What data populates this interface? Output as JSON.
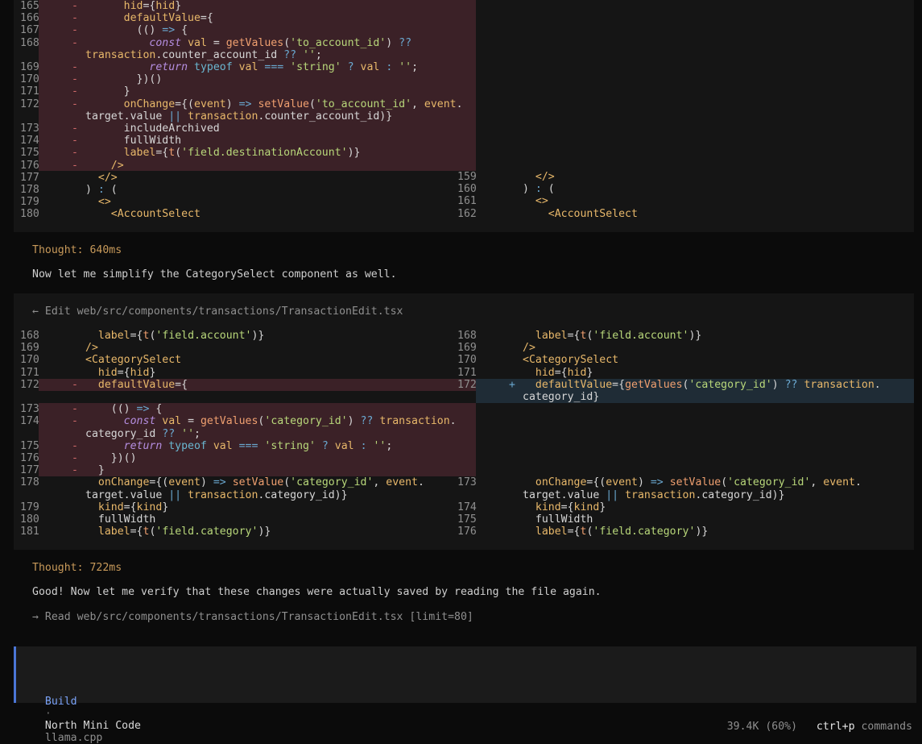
{
  "diff1": {
    "left": [
      {
        "n": "165",
        "m": "-",
        "code": "      hid={hid}",
        "del": true
      },
      {
        "n": "166",
        "m": "-",
        "code": "      defaultValue={",
        "del": true
      },
      {
        "n": "167",
        "m": "-",
        "code": "        (() => {",
        "del": true
      },
      {
        "n": "168",
        "m": "-",
        "code": "          const val = getValues('to_account_id') ??",
        "del": true
      },
      {
        "n": "",
        "m": "",
        "code": "transaction.counter_account_id ?? '';",
        "del": true
      },
      {
        "n": "169",
        "m": "-",
        "code": "          return typeof val === 'string' ? val : '';",
        "del": true
      },
      {
        "n": "170",
        "m": "-",
        "code": "        })()",
        "del": true
      },
      {
        "n": "171",
        "m": "-",
        "code": "      }",
        "del": true
      },
      {
        "n": "172",
        "m": "-",
        "code": "      onChange={(event) => setValue('to_account_id', event.",
        "del": true
      },
      {
        "n": "",
        "m": "",
        "code": "target.value || transaction.counter_account_id)}",
        "del": true
      },
      {
        "n": "173",
        "m": "-",
        "code": "      includeArchived",
        "del": true
      },
      {
        "n": "174",
        "m": "-",
        "code": "      fullWidth",
        "del": true
      },
      {
        "n": "175",
        "m": "-",
        "code": "      label={t('field.destinationAccount')}",
        "del": true
      },
      {
        "n": "176",
        "m": "-",
        "code": "    />",
        "del": true
      },
      {
        "n": "177",
        "m": "",
        "code": "  </>",
        "del": false
      },
      {
        "n": "178",
        "m": "",
        "code": ") : (",
        "del": false
      },
      {
        "n": "179",
        "m": "",
        "code": "  <>",
        "del": false
      },
      {
        "n": "180",
        "m": "",
        "code": "    <AccountSelect",
        "del": false
      }
    ],
    "right": [
      {
        "n": "159",
        "code": "  </>"
      },
      {
        "n": "160",
        "code": ") : ("
      },
      {
        "n": "161",
        "code": "  <>"
      },
      {
        "n": "162",
        "code": "    <AccountSelect"
      }
    ]
  },
  "thought1": "Thought: 640ms",
  "message1": "Now let me simplify the CategorySelect component as well.",
  "edit_header": "← Edit web/src/components/transactions/TransactionEdit.tsx",
  "diff2": {
    "left": [
      {
        "n": "168",
        "m": "",
        "code": "  label={t('field.account')}"
      },
      {
        "n": "169",
        "m": "",
        "code": "/>"
      },
      {
        "n": "170",
        "m": "",
        "code": "<CategorySelect"
      },
      {
        "n": "171",
        "m": "",
        "code": "  hid={hid}"
      },
      {
        "n": "172",
        "m": "-",
        "code": "  defaultValue={"
      },
      {
        "n": "173",
        "m": "-",
        "code": "    (() => {"
      },
      {
        "n": "174",
        "m": "-",
        "code": "      const val = getValues('category_id') ?? transaction."
      },
      {
        "n": "",
        "m": "",
        "code": "category_id ?? '';"
      },
      {
        "n": "175",
        "m": "-",
        "code": "      return typeof val === 'string' ? val : '';"
      },
      {
        "n": "176",
        "m": "-",
        "code": "    })()"
      },
      {
        "n": "177",
        "m": "-",
        "code": "  }"
      },
      {
        "n": "178",
        "m": "",
        "code": "  onChange={(event) => setValue('category_id', event."
      },
      {
        "n": "",
        "m": "",
        "code": "target.value || transaction.category_id)}"
      },
      {
        "n": "179",
        "m": "",
        "code": "  kind={kind}"
      },
      {
        "n": "180",
        "m": "",
        "code": "  fullWidth"
      },
      {
        "n": "181",
        "m": "",
        "code": "  label={t('field.category')}"
      }
    ],
    "right": [
      {
        "n": "168",
        "m": "",
        "code": "  label={t('field.account')}"
      },
      {
        "n": "169",
        "m": "",
        "code": "/>"
      },
      {
        "n": "170",
        "m": "",
        "code": "<CategorySelect"
      },
      {
        "n": "171",
        "m": "",
        "code": "  hid={hid}"
      },
      {
        "n": "172",
        "m": "+",
        "code": "  defaultValue={getValues('category_id') ?? transaction."
      },
      {
        "n": "",
        "m": "",
        "code": "category_id}"
      },
      {
        "n": "173",
        "m": "",
        "code": "  onChange={(event) => setValue('category_id', event."
      },
      {
        "n": "",
        "m": "",
        "code": "target.value || transaction.category_id)}"
      },
      {
        "n": "174",
        "m": "",
        "code": "  kind={kind}"
      },
      {
        "n": "175",
        "m": "",
        "code": "  fullWidth"
      },
      {
        "n": "176",
        "m": "",
        "code": "  label={t('field.category')}"
      }
    ]
  },
  "thought2": "Thought: 722ms",
  "message2": "Good! Now let me verify that these changes were actually saved by reading the file again.",
  "read_line": "→ Read web/src/components/transactions/TransactionEdit.tsx [limit=80]",
  "status": {
    "mode": "Build",
    "sep": "·",
    "model": "North Mini Code",
    "provider": "llama.cpp"
  },
  "footer": {
    "tokens": "39.4K (60%)",
    "shortcut": "ctrl+p",
    "shortcut_label": "commands"
  },
  "colors": {
    "background": "#0b0b0b",
    "panel": "#151515",
    "deleted_bg": "#3b2127",
    "added_bg": "#1f2c36",
    "accent": "#4b76d6",
    "thought": "#c89a5a"
  }
}
